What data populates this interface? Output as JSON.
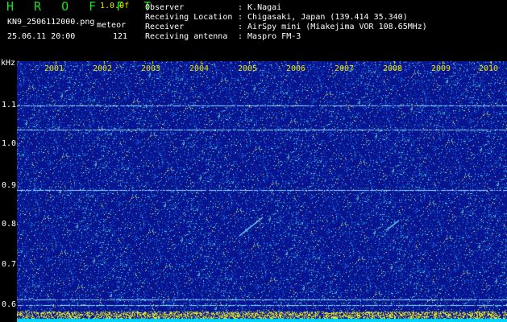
{
  "header": {
    "brand": "H R O F F T",
    "version": "1.0.0f",
    "filename": "KN9_2506112000.png",
    "mode_label": "meteor",
    "datetime": "25.06.11 20:00",
    "count": "121",
    "fields": [
      {
        "label": "Observer",
        "value": ": K.Nagai"
      },
      {
        "label": "Receiving Location",
        "value": ": Chigasaki, Japan (139.414 35.340)"
      },
      {
        "label": "Receiver",
        "value": ": AirSpy mini (Miakejima VOR 108.65MHz)"
      },
      {
        "label": "Receiving antenna",
        "value": ": Maspro FM-3"
      }
    ]
  },
  "axis": {
    "unit": "kHz",
    "y_ticks": [
      "1.1",
      "1.0",
      "0.9",
      "0.8",
      "0.7",
      "0.6"
    ],
    "x_ticks": [
      "2001",
      "2002",
      "2003",
      "2004",
      "2005",
      "2006",
      "2007",
      "2008",
      "2009",
      "2010"
    ]
  },
  "colors": {
    "background": "#000000",
    "spectrum_base": "#0a1890",
    "header_title": "#1be01b",
    "ticks": "#e8e800",
    "bottom_band": "#00d8ff"
  }
}
